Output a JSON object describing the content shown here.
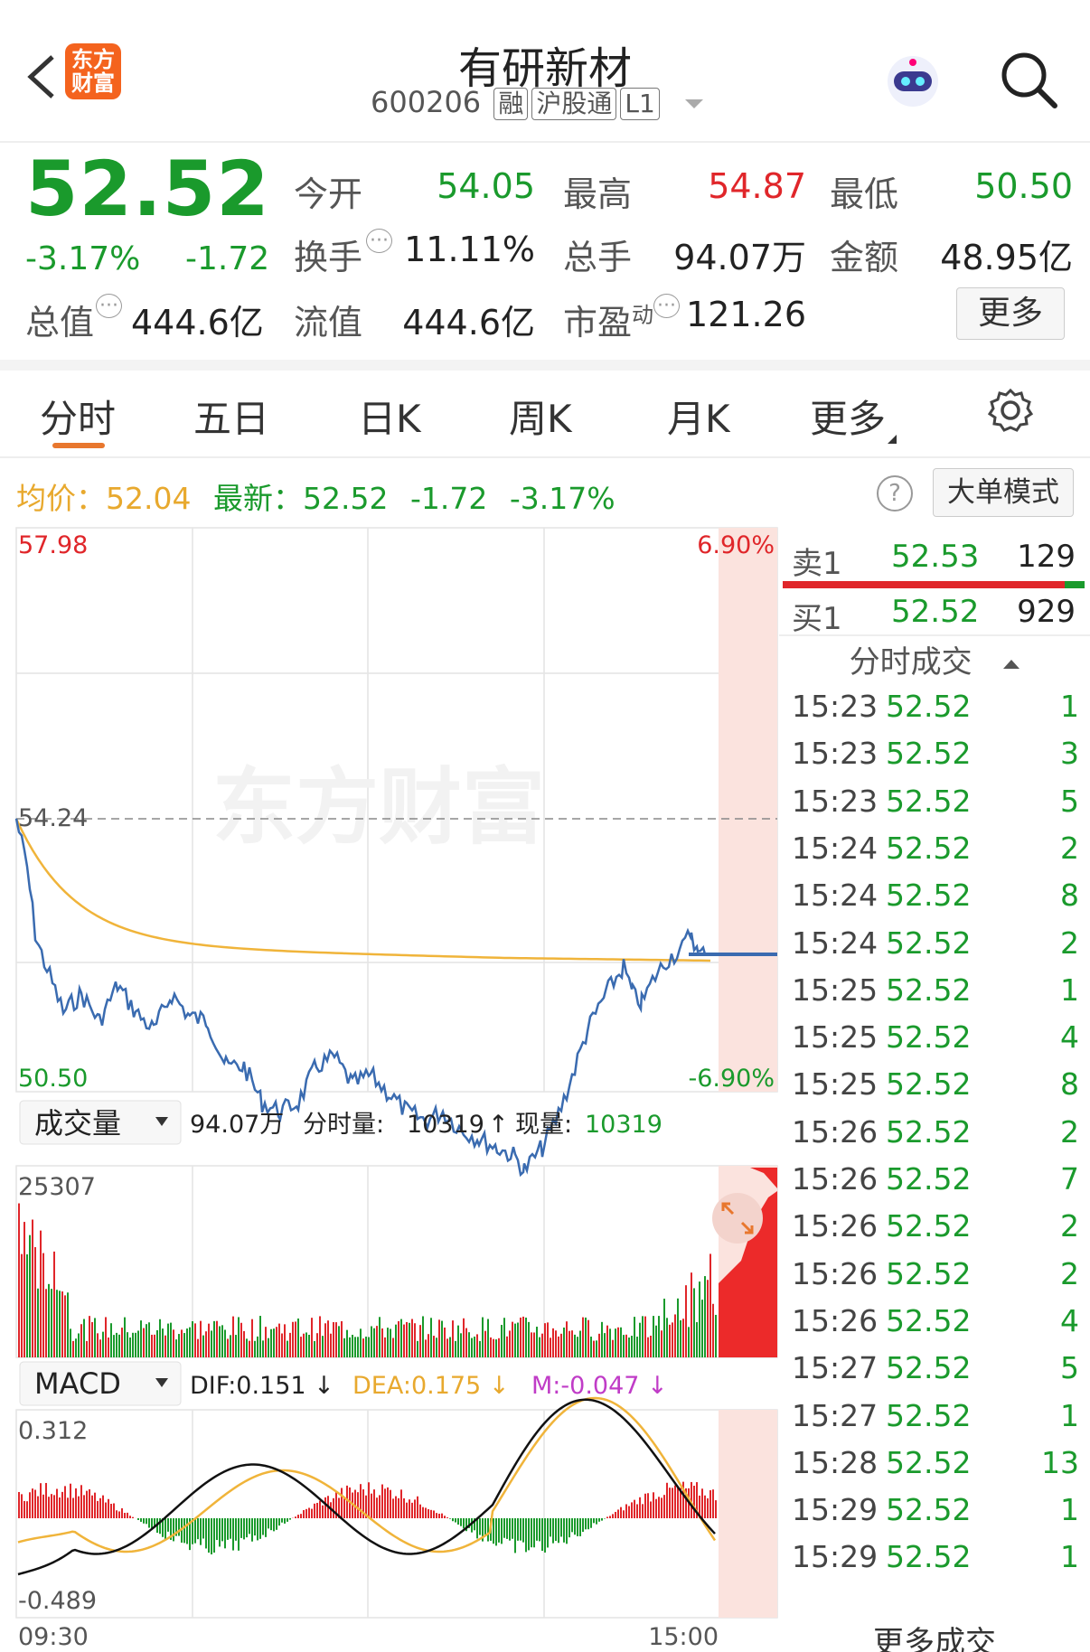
{
  "header": {
    "back_icon": "chevron-left-icon",
    "logo_line1": "东方",
    "logo_line2": "财富",
    "title": "有研新材",
    "code": "600206",
    "tags": [
      "融",
      "沪股通",
      "L1"
    ],
    "robot_icon": "robot-avatar-icon",
    "search_icon": "search-icon"
  },
  "quote": {
    "price": "52.52",
    "change_pct": "-3.17%",
    "change": "-1.72",
    "open_label": "今开",
    "open": "54.05",
    "high_label": "最高",
    "high": "54.87",
    "low_label": "最低",
    "low": "50.50",
    "turnover_label": "换手",
    "turnover": "11.11%",
    "volume_label": "总手",
    "volume": "94.07万",
    "amount_label": "金额",
    "amount": "48.95亿",
    "mktcap_label": "总值",
    "mktcap": "444.6亿",
    "float_label": "流值",
    "float": "444.6亿",
    "pe_label": "市盈",
    "pe_sup": "动",
    "pe": "121.26",
    "more_label": "更多"
  },
  "tabs": [
    "分时",
    "五日",
    "日K",
    "周K",
    "月K",
    "更多"
  ],
  "active_tab": 0,
  "info_bar": {
    "avg_label": "均价：",
    "avg": "52.04",
    "latest_label": "最新：",
    "latest": "52.52",
    "latest_change": "-1.72",
    "latest_pct": "-3.17%",
    "big_order_label": "大单模式"
  },
  "price_chart": {
    "y_top": "57.98",
    "y_prev": "54.24",
    "y_bottom": "50.50",
    "pct_top": "6.90%",
    "pct_bottom": "-6.90%",
    "watermark": "东方财富"
  },
  "volume_bar": {
    "selector": "成交量",
    "total": "94.07万",
    "minute_label": "分时量:",
    "minute_val": "10319",
    "arrow": "↑",
    "now_label": "现量:",
    "now_val": "10319",
    "y_max": "25307"
  },
  "macd_bar": {
    "selector": "MACD",
    "dif": "DIF:0.151 ↓",
    "dea": "DEA:0.175 ↓",
    "m": "M:-0.047 ↓",
    "y_top": "0.312",
    "y_bottom": "-0.489",
    "time_start": "09:30",
    "time_end": "15:00"
  },
  "order_book": {
    "sell_label": "卖1",
    "sell_price": "52.53",
    "sell_qty": "129",
    "buy_label": "买1",
    "buy_price": "52.52",
    "buy_qty": "929"
  },
  "trades": {
    "header": "分时成交",
    "rows": [
      [
        "15:23",
        "52.52",
        "1"
      ],
      [
        "15:23",
        "52.52",
        "3"
      ],
      [
        "15:23",
        "52.52",
        "5"
      ],
      [
        "15:24",
        "52.52",
        "2"
      ],
      [
        "15:24",
        "52.52",
        "8"
      ],
      [
        "15:24",
        "52.52",
        "2"
      ],
      [
        "15:25",
        "52.52",
        "1"
      ],
      [
        "15:25",
        "52.52",
        "4"
      ],
      [
        "15:25",
        "52.52",
        "8"
      ],
      [
        "15:26",
        "52.52",
        "2"
      ],
      [
        "15:26",
        "52.52",
        "7"
      ],
      [
        "15:26",
        "52.52",
        "2"
      ],
      [
        "15:26",
        "52.52",
        "2"
      ],
      [
        "15:26",
        "52.52",
        "4"
      ],
      [
        "15:27",
        "52.52",
        "5"
      ],
      [
        "15:27",
        "52.52",
        "1"
      ],
      [
        "15:28",
        "52.52",
        "13"
      ],
      [
        "15:29",
        "52.52",
        "1"
      ],
      [
        "15:29",
        "52.52",
        "1"
      ]
    ],
    "footer": "更多成交"
  },
  "colors": {
    "up": "#e0262a",
    "down": "#1a9a2c",
    "price_line": "#3a6bb0",
    "avg_line": "#f0b43a",
    "accent": "#e8772e"
  }
}
